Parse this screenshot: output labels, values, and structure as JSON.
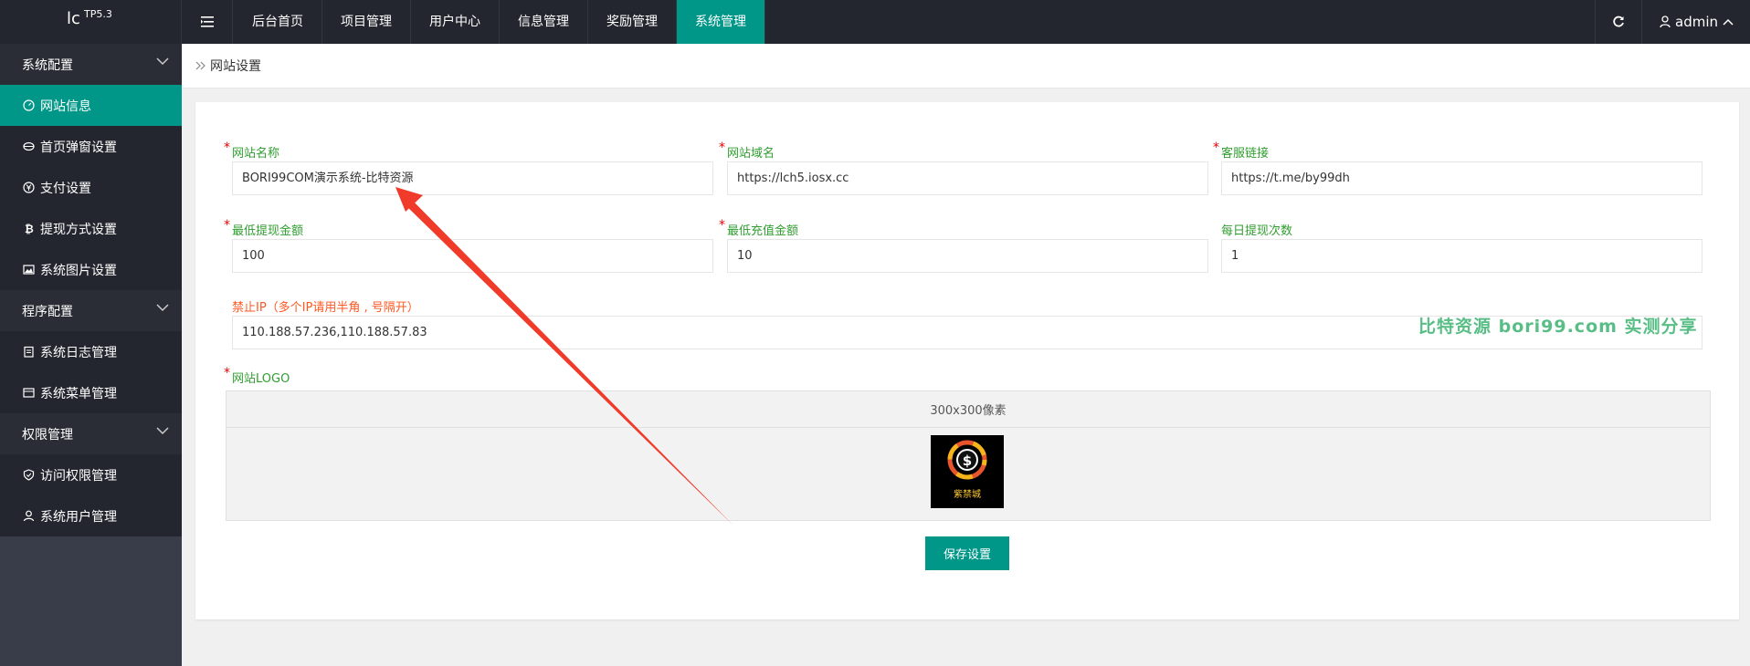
{
  "logo": {
    "main": "lc",
    "sup": "TP5.3"
  },
  "nav": [
    {
      "label": "后台首页",
      "active": false
    },
    {
      "label": "项目管理",
      "active": false
    },
    {
      "label": "用户中心",
      "active": false
    },
    {
      "label": "信息管理",
      "active": false
    },
    {
      "label": "奖励管理",
      "active": false
    },
    {
      "label": "系统管理",
      "active": true
    }
  ],
  "user": {
    "name": "admin"
  },
  "sidebar": {
    "group1": "系统配置",
    "items1": [
      "网站信息",
      "首页弹窗设置",
      "支付设置",
      "提现方式设置",
      "系统图片设置"
    ],
    "group2": "程序配置",
    "items2": [
      "系统日志管理",
      "系统菜单管理"
    ],
    "group3": "权限管理",
    "items3": [
      "访问权限管理",
      "系统用户管理"
    ]
  },
  "breadcrumb": "网站设置",
  "form": {
    "site_name": {
      "label": "网站名称",
      "value": "BORI99COM演示系统-比特资源"
    },
    "site_domain": {
      "label": "网站域名",
      "value": "https://lch5.iosx.cc"
    },
    "service_link": {
      "label": "客服链接",
      "value": "https://t.me/by99dh"
    },
    "min_withdraw": {
      "label": "最低提现金额",
      "value": "100"
    },
    "min_recharge": {
      "label": "最低充值金额",
      "value": "10"
    },
    "daily_withdraw": {
      "label": "每日提现次数",
      "value": "1"
    },
    "ban_ip": {
      "label": "禁止IP（多个IP请用半角 , 号隔开）",
      "value": "110.188.57.236,110.188.57.83"
    },
    "logo": {
      "label": "网站LOGO",
      "hint": "300x300像素",
      "brand": "紫禁城"
    },
    "save_label": "保存设置"
  },
  "watermark": "比特资源 bori99.com 实测分享",
  "colors": {
    "accent": "#009688",
    "header_bg": "#23262e",
    "sidebar_bg": "#393d49",
    "label_green": "#2f9e2f",
    "required_red": "#ee0000"
  }
}
